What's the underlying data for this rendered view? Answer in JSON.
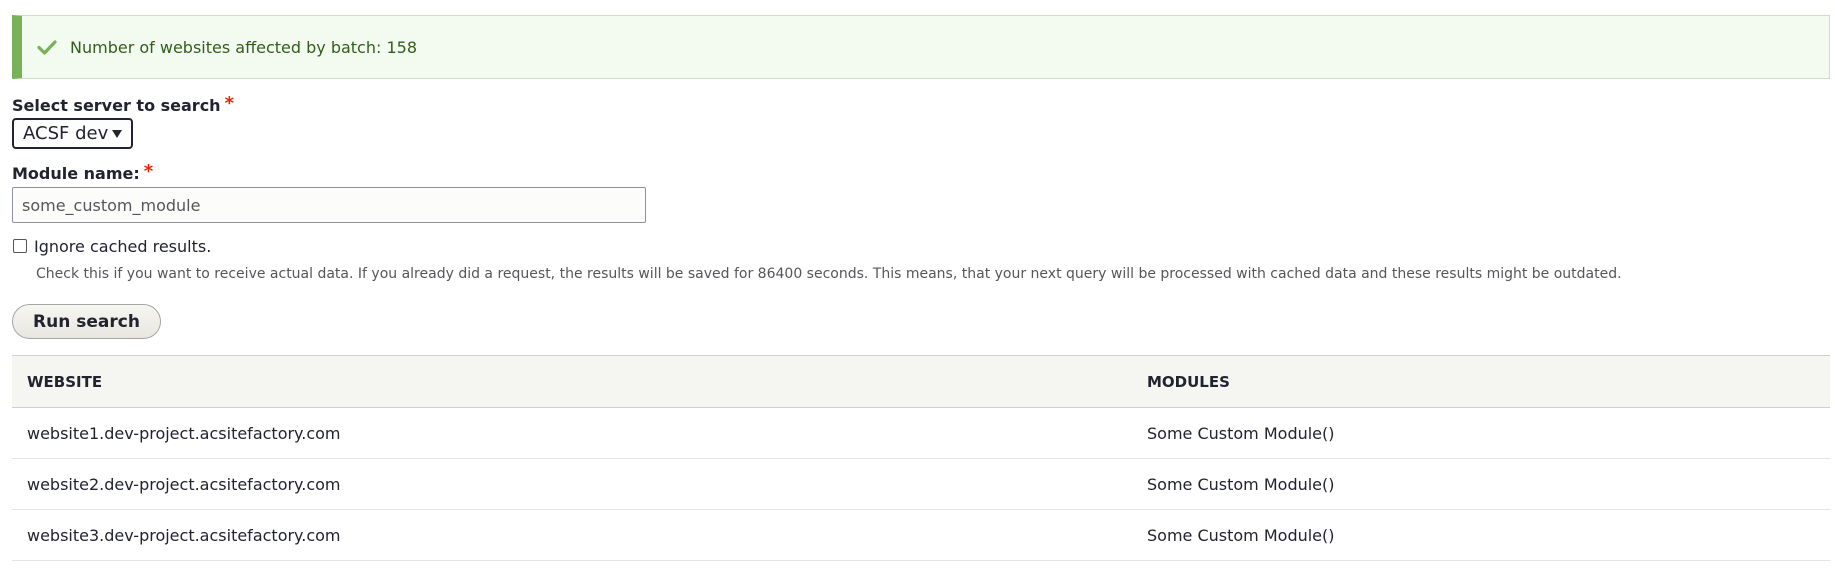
{
  "message": {
    "text": "Number of websites affected by batch: 158",
    "icon": "check-icon",
    "color": "#77b259"
  },
  "server_field": {
    "label": "Select server to search",
    "required_mark": "*",
    "selected_value": "ACSF dev"
  },
  "module_field": {
    "label": "Module name:",
    "required_mark": "*",
    "value": "some_custom_module"
  },
  "cache_option": {
    "label": "Ignore cached results.",
    "checked": false,
    "description": "Check this if you want to receive actual data. If you already did a request, the results will be saved for 86400 seconds. This means, that your next query will be processed with cached data and these results might be outdated."
  },
  "run_button": {
    "label": "Run search"
  },
  "results_table": {
    "headers": [
      "WEBSITE",
      "MODULES"
    ],
    "rows": [
      [
        "website1.dev-project.acsitefactory.com",
        "Some Custom Module()"
      ],
      [
        "website2.dev-project.acsitefactory.com",
        "Some Custom Module()"
      ],
      [
        "website3.dev-project.acsitefactory.com",
        "Some Custom Module()"
      ]
    ]
  }
}
